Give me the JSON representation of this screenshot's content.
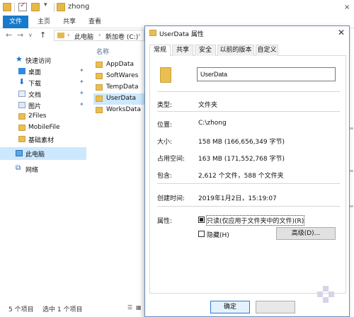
{
  "explorer": {
    "window_title": "zhong",
    "ribbon_tabs": [
      "文件",
      "主页",
      "共享",
      "查看"
    ],
    "address": [
      "此电脑",
      "新加卷 (C:)"
    ],
    "nav": [
      {
        "label": "快速访问"
      },
      {
        "label": "桌面"
      },
      {
        "label": "下载"
      },
      {
        "label": "文档"
      },
      {
        "label": "图片"
      },
      {
        "label": "2Files"
      },
      {
        "label": "MobileFile"
      },
      {
        "label": "基础素材"
      },
      {
        "label": "此电脑"
      },
      {
        "label": "网络"
      }
    ],
    "column_header": "名称",
    "files": [
      "AppData",
      "SoftWares",
      "TempData",
      "UserData",
      "WorksData"
    ],
    "status": {
      "count": "5 个项目",
      "selected": "选中 1 个项目"
    }
  },
  "dialog": {
    "title": "UserData 属性",
    "tabs": [
      "常规",
      "共享",
      "安全",
      "以前的版本",
      "自定义"
    ],
    "name": "UserData",
    "props": {
      "type_label": "类型:",
      "type_value": "文件夹",
      "location_label": "位置:",
      "location_value": "C:\\zhong",
      "size_label": "大小:",
      "size_value": "158 MB (166,656,349 字节)",
      "disk_label": "占用空间:",
      "disk_value": "163 MB (171,552,768 字节)",
      "contains_label": "包含:",
      "contains_value": "2,612 个文件，588 个文件夹",
      "created_label": "创建时间:",
      "created_value": "2019年1月2日，15:19:07",
      "attr_label": "属性:"
    },
    "readonly_label": "只读(仅应用于文件夹中的文件)(R)",
    "hidden_label": "隐藏(H)",
    "advanced_label": "高级(D)...",
    "ok_label": "确定"
  }
}
